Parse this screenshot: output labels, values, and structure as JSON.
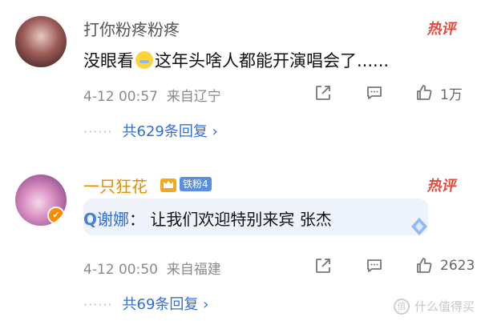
{
  "comments": [
    {
      "username": "打你粉疼粉疼",
      "hot_label": "热评",
      "content_before": "没眼看",
      "emoji_icon": "tears-face-emoji",
      "content_after": "这年头啥人都能开演唱会了......",
      "timestamp": "4-12 00:57",
      "location": "来自辽宁",
      "likes": "1万",
      "replies_label": "共629条回复",
      "reply_chevron": "›",
      "dots": "······"
    },
    {
      "username": "一只狂花",
      "hot_label": "热评",
      "fan_badge": "铁粉4",
      "quote_icon": "Q",
      "quote_name": "谢娜",
      "quote_text": "： 让我们欢迎特别来宾 张杰",
      "timestamp": "4-12 00:50",
      "location": "来自福建",
      "likes": "2623",
      "replies_label": "共69条回复",
      "reply_chevron": "›",
      "dots": "······"
    }
  ],
  "watermark": {
    "icon": "值",
    "text": "什么值得买"
  }
}
